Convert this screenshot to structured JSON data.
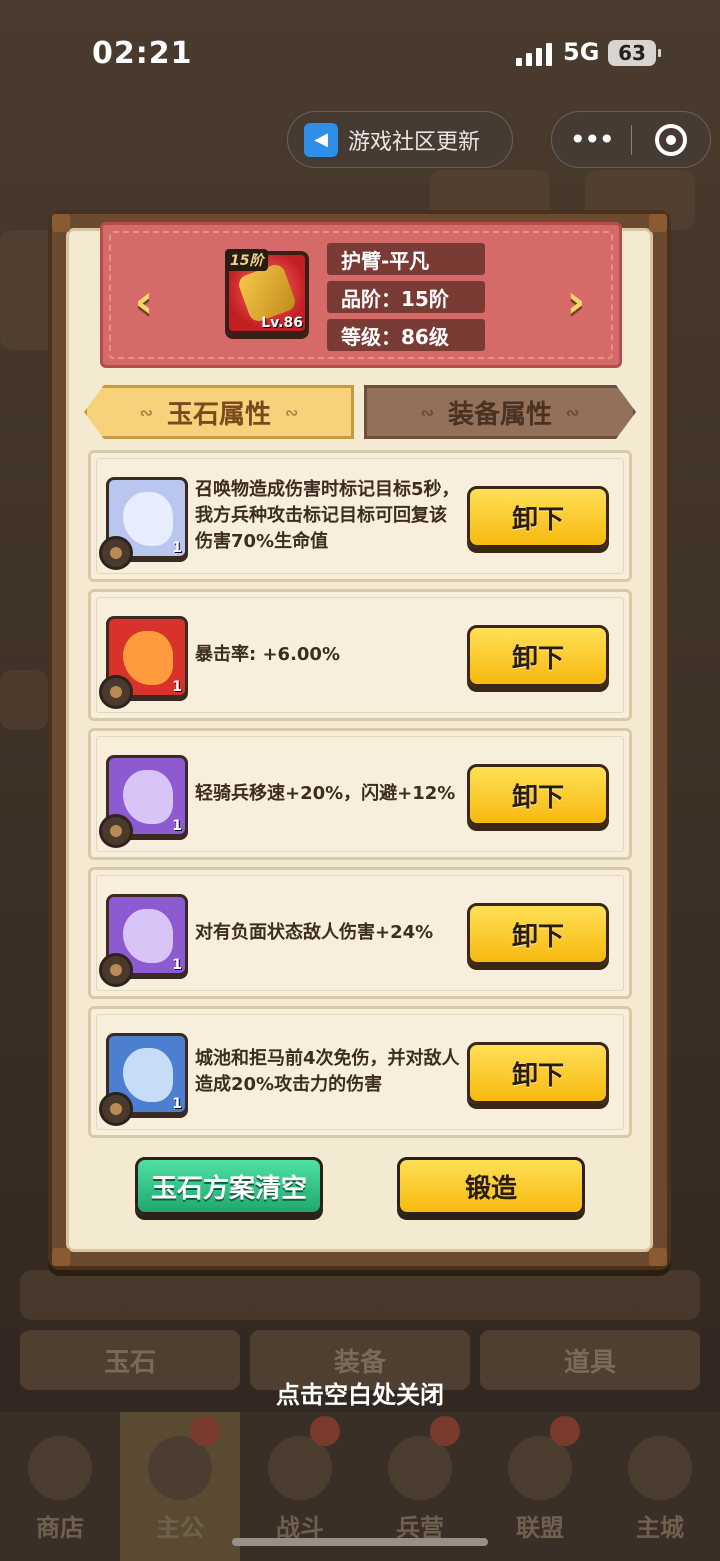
{
  "status_bar": {
    "time": "02:21",
    "network": "5G",
    "battery": "63"
  },
  "top_capsule": {
    "notice": "游戏社区更新",
    "more": "•••"
  },
  "item": {
    "name": "护臂-平凡",
    "grade": "品阶：15阶",
    "level": "等级：86级",
    "tier_badge": "15阶",
    "level_badge": "Lv.86",
    "prev_arrow": "‹",
    "next_arrow": "›"
  },
  "tabs": [
    {
      "label": "玉石属性",
      "active": true
    },
    {
      "label": "装备属性",
      "active": false
    }
  ],
  "gem_slots": [
    {
      "description": "召唤物造成伤害时标记目标5秒，我方兵种攻击标记目标可回复该伤害70%生命值",
      "count": "1",
      "icon": "silver-dragon-gem-icon",
      "color": "#b9c6ef",
      "shape_color": "#e8ecff",
      "action": "卸下"
    },
    {
      "description": "暴击率: +6.00%",
      "count": "1",
      "icon": "red-flame-gem-icon",
      "color": "#d8322b",
      "shape_color": "#ff9a3d",
      "action": "卸下"
    },
    {
      "description": "轻骑兵移速+20%，闪避+12%",
      "count": "1",
      "icon": "purple-gem-icon",
      "color": "#8c5ad1",
      "shape_color": "#d9c4f7",
      "action": "卸下"
    },
    {
      "description": "对有负面状态敌人伤害+24%",
      "count": "1",
      "icon": "purple-gem-icon",
      "color": "#8c5ad1",
      "shape_color": "#d9c4f7",
      "action": "卸下"
    },
    {
      "description": "城池和拒马前4次免伤，并对敌人造成20%攻击力的伤害",
      "count": "1",
      "icon": "blue-gem-icon",
      "color": "#4d7fd0",
      "shape_color": "#c7dcf7",
      "action": "卸下"
    }
  ],
  "buttons": {
    "clear_plan": "玉石方案清空",
    "forge": "锻造"
  },
  "close_hint": "点击空白处关闭",
  "background": {
    "tabs": [
      "玉石",
      "装备",
      "道具"
    ],
    "nav": [
      "商店",
      "主公",
      "战斗",
      "兵营",
      "联盟",
      "主城"
    ]
  }
}
